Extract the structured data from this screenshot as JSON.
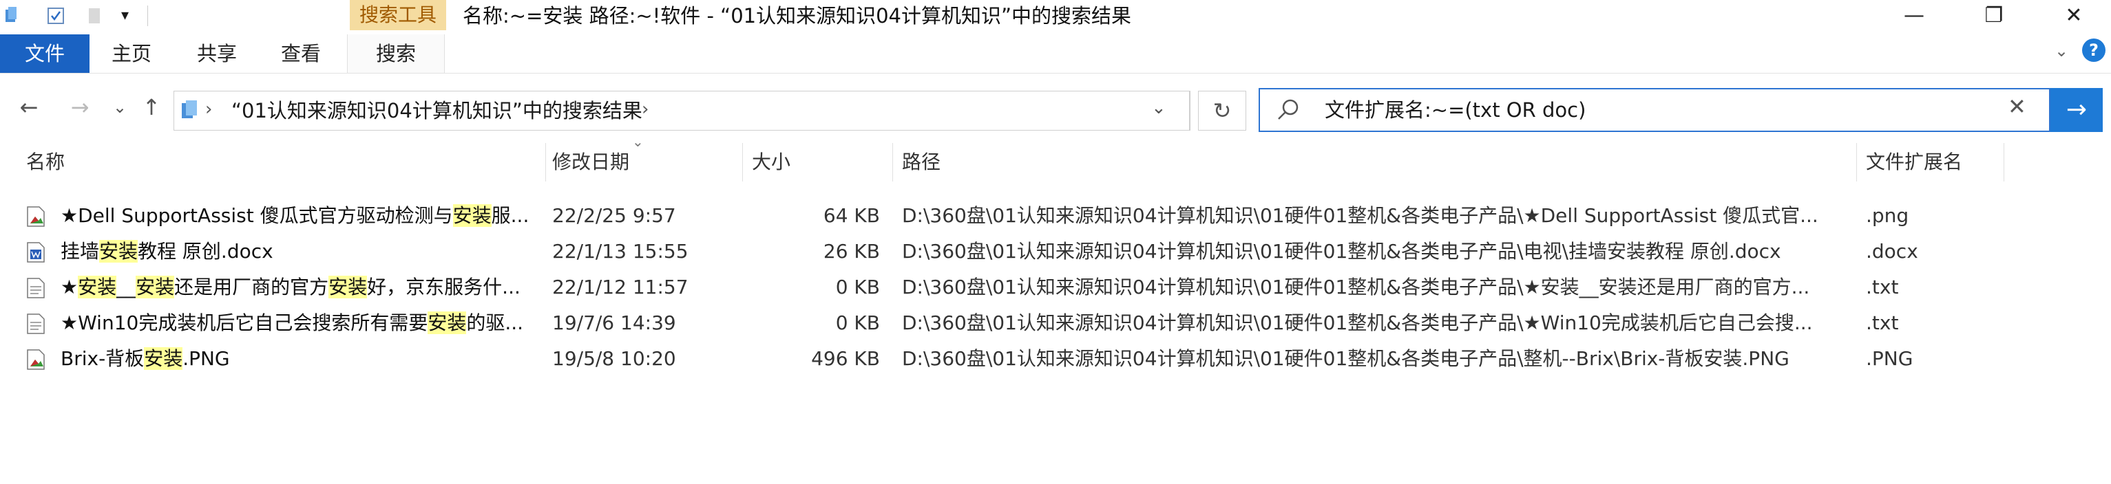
{
  "window": {
    "context_tab": "搜索工具",
    "title": "名称:~=安装 路径:~!软件 - “01认知来源知识04计算机知识”中的搜索结果",
    "controls": [
      "—",
      "❐",
      "✕"
    ]
  },
  "ribbon": {
    "tabs": [
      "文件",
      "主页",
      "共享",
      "查看",
      "搜索"
    ]
  },
  "nav": {
    "back": "←",
    "forward": "→",
    "recent": "⌄",
    "up": "↑",
    "address": "“01认知来源知识04计算机知识”中的搜索结果",
    "refresh": "↻"
  },
  "search": {
    "value": "文件扩展名:~=(txt OR doc)",
    "clear": "✕",
    "go": "→"
  },
  "columns": [
    "名称",
    "修改日期",
    "大小",
    "路径",
    "文件扩展名"
  ],
  "files": [
    {
      "name_parts": [
        "★Dell SupportAssist 傻瓜式官方驱动检测与",
        "安装",
        "服..."
      ],
      "date": "22/2/25 9:57",
      "size": "64 KB",
      "path": "D:\\360盘\\01认知来源知识04计算机知识\\01硬件01整机&各类电子产品\\★Dell SupportAssist 傻瓜式官...",
      "ext": ".png",
      "icon": "image-file-icon"
    },
    {
      "name_parts": [
        "挂墙",
        "安装",
        "教程 原创.docx"
      ],
      "date": "22/1/13 15:55",
      "size": "26 KB",
      "path": "D:\\360盘\\01认知来源知识04计算机知识\\01硬件01整机&各类电子产品\\电视\\挂墙安装教程 原创.docx",
      "ext": ".docx",
      "icon": "document-file-icon"
    },
    {
      "name_parts": [
        "★",
        "安装",
        "__",
        "安装",
        "还是用厂商的官方",
        "安装",
        "好，京东服务什..."
      ],
      "date": "22/1/12 11:57",
      "size": "0 KB",
      "path": "D:\\360盘\\01认知来源知识04计算机知识\\01硬件01整机&各类电子产品\\★安装__安装还是用厂商的官方...",
      "ext": ".txt",
      "icon": "text-file-icon"
    },
    {
      "name_parts": [
        "★Win10完成装机后它自己会搜索所有需要",
        "安装",
        "的驱..."
      ],
      "date": "19/7/6 14:39",
      "size": "0 KB",
      "path": "D:\\360盘\\01认知来源知识04计算机知识\\01硬件01整机&各类电子产品\\★Win10完成装机后它自己会搜...",
      "ext": ".txt",
      "icon": "text-file-icon"
    },
    {
      "name_parts": [
        "Brix-背板",
        "安装",
        ".PNG"
      ],
      "date": "19/5/8 10:20",
      "size": "496 KB",
      "path": "D:\\360盘\\01认知来源知识04计算机知识\\01硬件01整机&各类电子产品\\整机--Brix\\Brix-背板安装.PNG",
      "ext": ".PNG",
      "icon": "image-file-icon"
    }
  ],
  "colors": {
    "accent": "#1a62c2",
    "highlight": "#ffff9a",
    "context_tab": "#f5dca0"
  }
}
